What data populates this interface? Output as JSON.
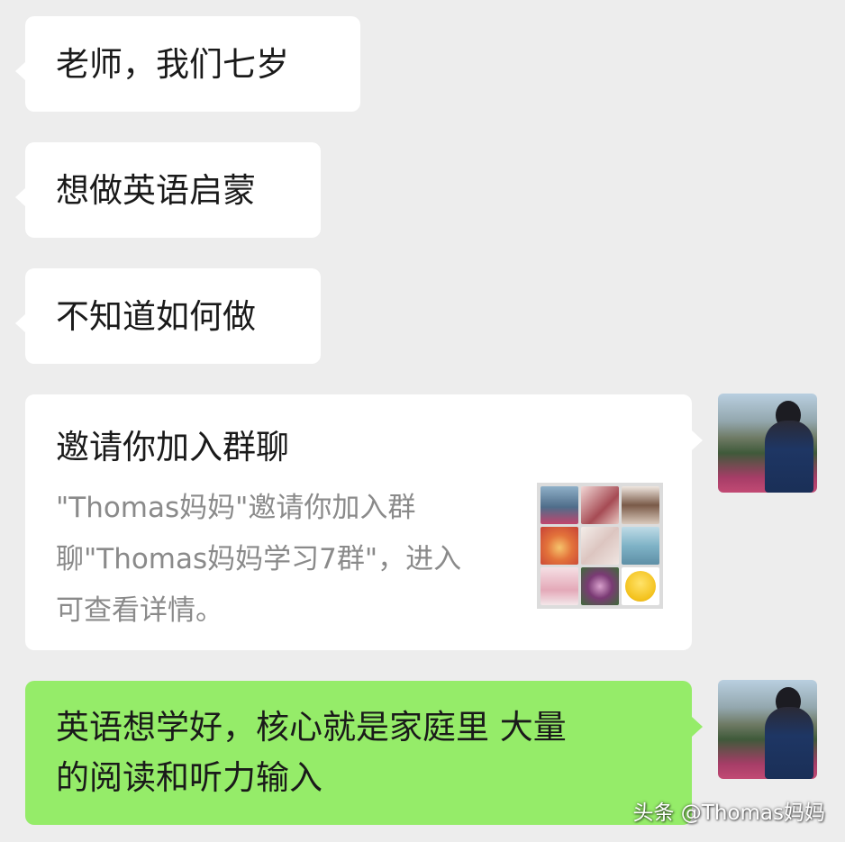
{
  "messages": [
    {
      "text": "老师，我们七岁"
    },
    {
      "text": "想做英语启蒙"
    },
    {
      "text": "不知道如何做"
    }
  ],
  "invite_card": {
    "title": "邀请你加入群聊",
    "description_lines": [
      "\"Thomas妈妈\"邀请你加入群",
      "聊\"Thomas妈妈学习7群\"，进入",
      "可查看详情。"
    ]
  },
  "reply": {
    "lines": [
      "英语想学好，核心就是家庭里 大量",
      "的阅读和听力输入"
    ]
  },
  "watermark": "头条 @Thomas妈妈",
  "colors": {
    "background": "#ededed",
    "incoming_bubble": "#ffffff",
    "outgoing_bubble": "#95ec69",
    "secondary_text": "#8a8a8a"
  }
}
